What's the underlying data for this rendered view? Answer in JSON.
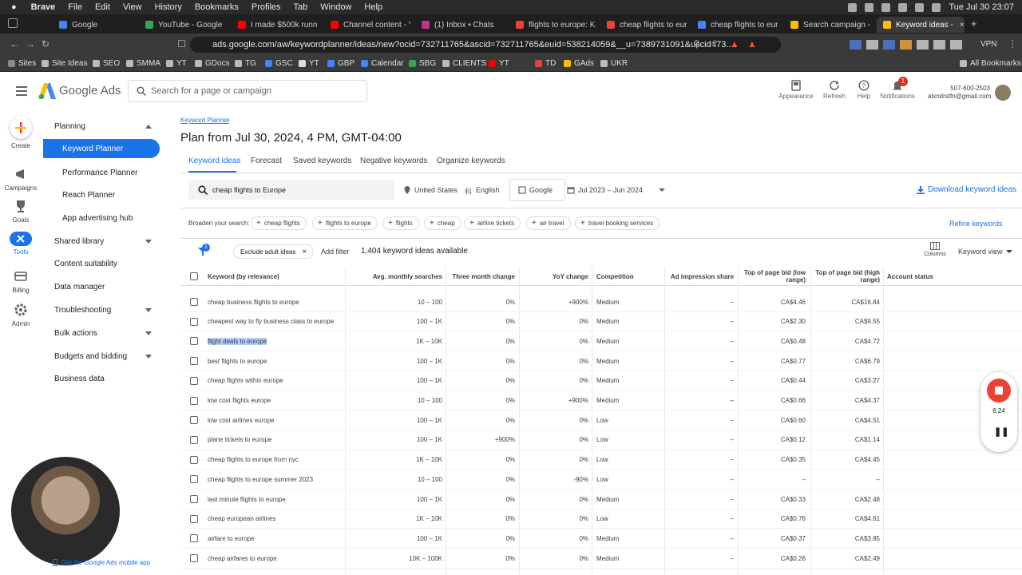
{
  "macos_menu": {
    "app": "Brave",
    "items": [
      "File",
      "Edit",
      "View",
      "History",
      "Bookmarks",
      "Profiles",
      "Tab",
      "Window",
      "Help"
    ],
    "clock": "Tue Jul 30  23:07"
  },
  "browser": {
    "tabs": [
      {
        "label": "Google",
        "color": "#4285f4"
      },
      {
        "label": "YouTube - Google Sh",
        "color": "#34a853"
      },
      {
        "label": "I made $500k running",
        "color": "#ff0000"
      },
      {
        "label": "Channel content - Yo",
        "color": "#ff0000"
      },
      {
        "label": "(1) Inbox • Chats",
        "color": "#c13584"
      },
      {
        "label": "flights to europe: Key",
        "color": "#ea4335"
      },
      {
        "label": "cheap flights to europ",
        "color": "#ea4335"
      },
      {
        "label": "cheap flights to europ",
        "color": "#4285f4"
      },
      {
        "label": "Search campaign - Si",
        "color": "#fbbc04"
      },
      {
        "label": "Keyword ideas - ",
        "color": "#fbbc04",
        "active": true
      }
    ],
    "url": "ads.google.com/aw/keywordplanner/ideas/new?ocid=732711765&ascid=732711765&euid=538214059&__u=7389731091&uscid=73...",
    "vpn_label": "VPN",
    "bookmarks": [
      "Sites",
      "Site Ideas",
      "SEO",
      "SMMA",
      "YT",
      "GDocs",
      "TG",
      "GSC",
      "YT",
      "GBP",
      "Calendar",
      "SBG",
      "CLIENTS",
      "YT",
      "TD",
      "GAds",
      "UKR"
    ],
    "all_bookmarks": "All Bookmarks"
  },
  "header": {
    "brand": "Google Ads",
    "search_placeholder": "Search for a page or campaign",
    "buttons": {
      "appearance": "Appearance",
      "refresh": "Refresh",
      "help": "Help",
      "notifications": "Notifications"
    },
    "notification_count": "1",
    "account_phone": "507-600-2503",
    "account_email": "alxndrstfn@gmail.com"
  },
  "rail": {
    "create": "Create",
    "campaigns": "Campaigns",
    "goals": "Goals",
    "tools": "Tools",
    "billing": "Billing",
    "admin": "Admin"
  },
  "nav": {
    "planning": "Planning",
    "keyword_planner": "Keyword Planner",
    "performance_planner": "Performance Planner",
    "reach_planner": "Reach Planner",
    "app_advertising_hub": "App advertising hub",
    "shared_library": "Shared library",
    "content_suitability": "Content suitability",
    "data_manager": "Data manager",
    "troubleshooting": "Troubleshooting",
    "bulk_actions": "Bulk actions",
    "budgets_and_bidding": "Budgets and bidding",
    "business_data": "Business data"
  },
  "main": {
    "breadcrumb": "Keyword Planner",
    "title": "Plan from Jul 30, 2024, 4 PM, GMT-04:00",
    "tabs": [
      "Keyword ideas",
      "Forecast",
      "Saved keywords",
      "Negative keywords",
      "Organize keywords"
    ],
    "keyword_query": "cheap flights to Europe",
    "location": "United States",
    "language": "English",
    "network": "Google",
    "date_range": "Jul 2023 – Jun 2024",
    "download": "Download keyword ideas",
    "broaden_label": "Broaden your search:",
    "broaden_chips": [
      "cheap flights",
      "flights to europe",
      "flights",
      "cheap",
      "airline tickets",
      "air travel",
      "travel booking services"
    ],
    "refine": "Refine keywords",
    "filter_badge": "1",
    "exclude_chip": "Exclude adult ideas",
    "add_filter": "Add filter",
    "ideas_count": "1,404 keyword ideas available",
    "columns_label": "Columns",
    "keyword_view": "Keyword view"
  },
  "table": {
    "headers": [
      "Keyword (by relevance)",
      "Avg. monthly searches",
      "Three month change",
      "YoY change",
      "Competition",
      "Ad impression share",
      "Top of page bid (low range)",
      "Top of page bid (high range)",
      "Account status"
    ],
    "rows": [
      [
        "cheap business flights to europe",
        "10 – 100",
        "0%",
        "+900%",
        "Medium",
        "–",
        "CA$4.46",
        "CA$16.84"
      ],
      [
        "cheapest way to fly business class to europe",
        "100 – 1K",
        "0%",
        "0%",
        "Medium",
        "–",
        "CA$2.30",
        "CA$9.55"
      ],
      [
        "flight deals to europe",
        "1K – 10K",
        "0%",
        "0%",
        "Medium",
        "–",
        "CA$0.48",
        "CA$4.72"
      ],
      [
        "best flights to europe",
        "100 – 1K",
        "0%",
        "0%",
        "Medium",
        "–",
        "CA$0.77",
        "CA$6.79"
      ],
      [
        "cheap flights within europe",
        "100 – 1K",
        "0%",
        "0%",
        "Medium",
        "–",
        "CA$0.44",
        "CA$3.27"
      ],
      [
        "low cost flights europe",
        "10 – 100",
        "0%",
        "+900%",
        "Medium",
        "–",
        "CA$0.66",
        "CA$4.37"
      ],
      [
        "low cost airlines europe",
        "100 – 1K",
        "0%",
        "0%",
        "Low",
        "–",
        "CA$0.60",
        "CA$4.51"
      ],
      [
        "plane tickets to europe",
        "100 – 1K",
        "+900%",
        "0%",
        "Low",
        "–",
        "CA$0.12",
        "CA$1.14"
      ],
      [
        "cheap flights to europe from nyc",
        "1K – 10K",
        "0%",
        "0%",
        "Low",
        "–",
        "CA$0.35",
        "CA$4.45"
      ],
      [
        "cheap flights to europe summer 2023",
        "10 – 100",
        "0%",
        "-90%",
        "Low",
        "–",
        "–",
        "–"
      ],
      [
        "last minute flights to europe",
        "100 – 1K",
        "0%",
        "0%",
        "Medium",
        "–",
        "CA$0.33",
        "CA$2.48"
      ],
      [
        "cheap european airlines",
        "1K – 10K",
        "0%",
        "0%",
        "Low",
        "–",
        "CA$0.76",
        "CA$4.61"
      ],
      [
        "airfare to europe",
        "100 – 1K",
        "0%",
        "0%",
        "Medium",
        "–",
        "CA$0.37",
        "CA$3.85"
      ],
      [
        "cheap airfares to europe",
        "10K – 100K",
        "0%",
        "0%",
        "Medium",
        "–",
        "CA$0.26",
        "CA$2.49"
      ]
    ],
    "selected_row": 2
  },
  "recorder": {
    "time": "6:24"
  },
  "mobile_app_link": "Get the Google Ads mobile app"
}
